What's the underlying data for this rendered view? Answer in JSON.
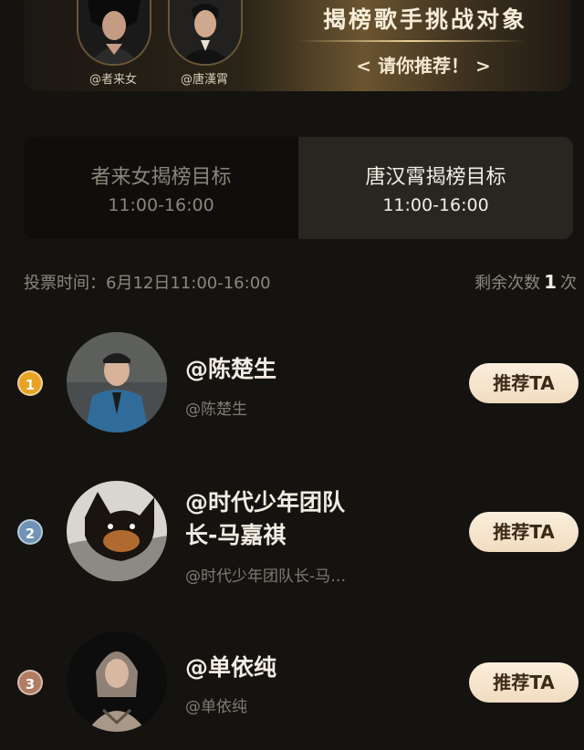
{
  "banner": {
    "title": "揭榜歌手挑战对象",
    "subtitle": "< 请你推荐！ >",
    "singers": [
      {
        "handle": "@者来女"
      },
      {
        "handle": "@唐漢霄"
      }
    ],
    "accent": "#6b5530"
  },
  "tabs": [
    {
      "label": "者来女揭榜目标",
      "time": "11:00-16:00",
      "active": false
    },
    {
      "label": "唐汉霄揭榜目标",
      "time": "11:00-16:00",
      "active": true
    }
  ],
  "vote": {
    "time_text": "投票时间：6月12日11:00-16:00",
    "remain_prefix": "剩余次数",
    "remain_count": "1",
    "remain_suffix": "次"
  },
  "candidates": [
    {
      "rank": "1",
      "rank_color": "#e7a324",
      "name": "@陈楚生",
      "handle": "@陈楚生",
      "button": "推荐TA"
    },
    {
      "rank": "2",
      "rank_color": "#6f92b5",
      "name": "@时代少年团队长-马嘉祺",
      "handle": "@时代少年团队长-马…",
      "button": "推荐TA"
    },
    {
      "rank": "3",
      "rank_color": "#b07c62",
      "name": "@单依纯",
      "handle": "@单依纯",
      "button": "推荐TA"
    }
  ]
}
